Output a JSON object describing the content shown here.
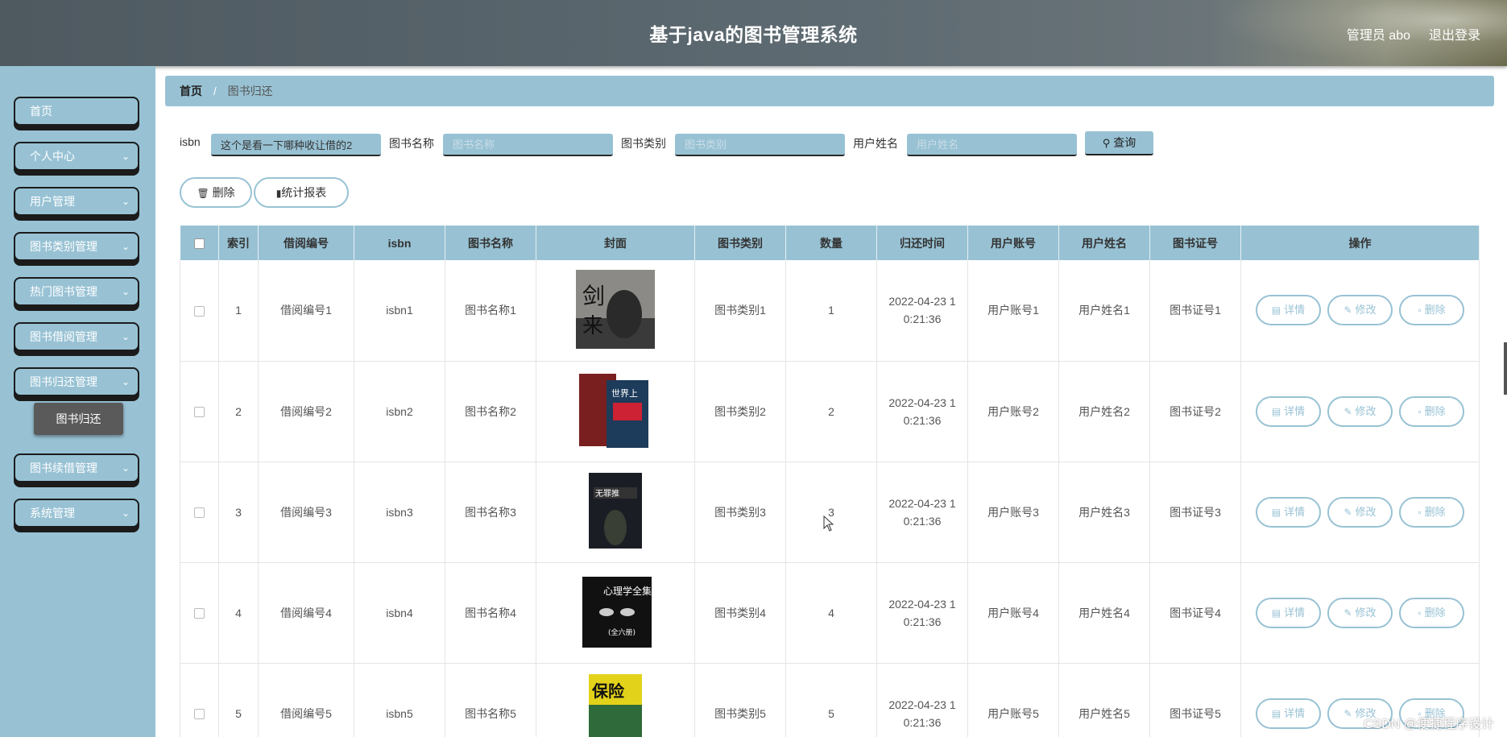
{
  "header": {
    "title": "基于java的图书管理系统",
    "user_label": "管理员 abo",
    "logout_label": "退出登录"
  },
  "sidebar": {
    "items": [
      {
        "label": "首页",
        "has_children": false
      },
      {
        "label": "个人中心",
        "has_children": true
      },
      {
        "label": "用户管理",
        "has_children": true
      },
      {
        "label": "图书类别管理",
        "has_children": true
      },
      {
        "label": "热门图书管理",
        "has_children": true
      },
      {
        "label": "图书借阅管理",
        "has_children": true
      },
      {
        "label": "图书归还管理",
        "has_children": true
      },
      {
        "label": "图书续借管理",
        "has_children": true
      },
      {
        "label": "系统管理",
        "has_children": true
      }
    ],
    "active_sub": "图书归还"
  },
  "breadcrumb": {
    "home": "首页",
    "separator": "/",
    "current": "图书归还"
  },
  "search": {
    "isbn_label": "isbn",
    "isbn_value": "这个是看一下哪种收让借的2",
    "name_label": "图书名称",
    "name_placeholder": "图书名称",
    "category_label": "图书类别",
    "category_placeholder": "图书类别",
    "username_label": "用户姓名",
    "username_placeholder": "用户姓名",
    "query_label": "查询"
  },
  "actions": {
    "delete_label": "删除",
    "report_label": "统计报表"
  },
  "table": {
    "headers": [
      "",
      "索引",
      "借阅编号",
      "isbn",
      "图书名称",
      "封面",
      "图书类别",
      "数量",
      "归还时间",
      "用户账号",
      "用户姓名",
      "图书证号",
      "操作"
    ],
    "rows": [
      {
        "index": "1",
        "borrow_no": "借阅编号1",
        "isbn": "isbn1",
        "name": "图书名称1",
        "category": "图书类别1",
        "qty": "1",
        "time": "2022-04-23 10:21:36",
        "account": "用户账号1",
        "username": "用户姓名1",
        "card": "图书证号1"
      },
      {
        "index": "2",
        "borrow_no": "借阅编号2",
        "isbn": "isbn2",
        "name": "图书名称2",
        "category": "图书类别2",
        "qty": "2",
        "time": "2022-04-23 10:21:36",
        "account": "用户账号2",
        "username": "用户姓名2",
        "card": "图书证号2"
      },
      {
        "index": "3",
        "borrow_no": "借阅编号3",
        "isbn": "isbn3",
        "name": "图书名称3",
        "category": "图书类别3",
        "qty": "3",
        "time": "2022-04-23 10:21:36",
        "account": "用户账号3",
        "username": "用户姓名3",
        "card": "图书证号3"
      },
      {
        "index": "4",
        "borrow_no": "借阅编号4",
        "isbn": "isbn4",
        "name": "图书名称4",
        "category": "图书类别4",
        "qty": "4",
        "time": "2022-04-23 10:21:36",
        "account": "用户账号4",
        "username": "用户姓名4",
        "card": "图书证号4"
      },
      {
        "index": "5",
        "borrow_no": "借阅编号5",
        "isbn": "isbn5",
        "name": "图书名称5",
        "category": "图书类别5",
        "qty": "5",
        "time": "2022-04-23 10:21:36",
        "account": "用户账号5",
        "username": "用户姓名5",
        "card": "图书证号5"
      }
    ],
    "op_labels": {
      "detail": "详情",
      "edit": "修改",
      "delete": "删除"
    }
  },
  "covers": [
    {
      "icon": "book-cover-jianlai",
      "caption": "剑来"
    },
    {
      "icon": "book-cover-world",
      "caption": "世界上"
    },
    {
      "icon": "book-cover-dark",
      "caption": "无罪推定"
    },
    {
      "icon": "book-cover-psychology",
      "caption": "心理学全集"
    },
    {
      "icon": "book-cover-insurance",
      "caption": "保险"
    }
  ],
  "watermark": "CSDN @便捷程序设计",
  "colors": {
    "accent": "#98c2d4",
    "header": "#5a656c",
    "dark": "#1b1b1b"
  }
}
